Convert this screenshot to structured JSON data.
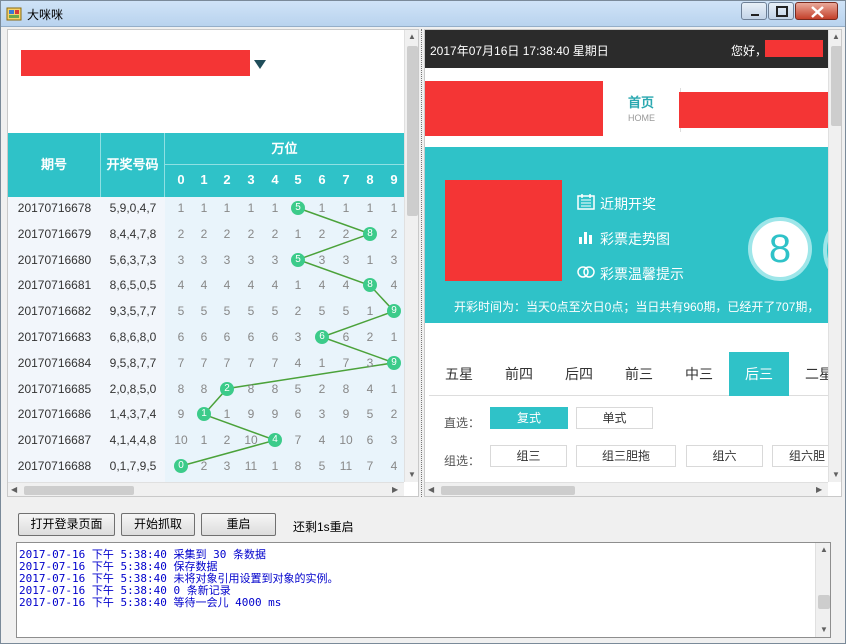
{
  "window": {
    "title": "大咪咪"
  },
  "left_pane": {
    "headers": {
      "qihao": "期号",
      "kaijiang": "开奖号码",
      "wanwei": "万位",
      "digits": [
        "0",
        "1",
        "2",
        "3",
        "4",
        "5",
        "6",
        "7",
        "8",
        "9"
      ]
    },
    "rows": [
      {
        "qihao": "20170716678",
        "kaijiang": "5,9,0,4,7",
        "cells": [
          "1",
          "1",
          "1",
          "1",
          "1",
          "5",
          "1",
          "1",
          "1",
          "1"
        ],
        "hit": 5
      },
      {
        "qihao": "20170716679",
        "kaijiang": "8,4,4,7,8",
        "cells": [
          "2",
          "2",
          "2",
          "2",
          "2",
          "1",
          "2",
          "2",
          "8",
          "2"
        ],
        "hit": 8
      },
      {
        "qihao": "20170716680",
        "kaijiang": "5,6,3,7,3",
        "cells": [
          "3",
          "3",
          "3",
          "3",
          "3",
          "5",
          "3",
          "3",
          "1",
          "3"
        ],
        "hit": 5
      },
      {
        "qihao": "20170716681",
        "kaijiang": "8,6,5,0,5",
        "cells": [
          "4",
          "4",
          "4",
          "4",
          "4",
          "1",
          "4",
          "4",
          "8",
          "4"
        ],
        "hit": 8
      },
      {
        "qihao": "20170716682",
        "kaijiang": "9,3,5,7,7",
        "cells": [
          "5",
          "5",
          "5",
          "5",
          "5",
          "2",
          "5",
          "5",
          "1",
          "9"
        ],
        "hit": 9
      },
      {
        "qihao": "20170716683",
        "kaijiang": "6,8,6,8,0",
        "cells": [
          "6",
          "6",
          "6",
          "6",
          "6",
          "3",
          "6",
          "6",
          "2",
          "1"
        ],
        "hit": 6
      },
      {
        "qihao": "20170716684",
        "kaijiang": "9,5,8,7,7",
        "cells": [
          "7",
          "7",
          "7",
          "7",
          "7",
          "4",
          "1",
          "7",
          "3",
          "9"
        ],
        "hit": 9
      },
      {
        "qihao": "20170716685",
        "kaijiang": "2,0,8,5,0",
        "cells": [
          "8",
          "8",
          "2",
          "8",
          "8",
          "5",
          "2",
          "8",
          "4",
          "1"
        ],
        "hit": 2
      },
      {
        "qihao": "20170716686",
        "kaijiang": "1,4,3,7,4",
        "cells": [
          "9",
          "1",
          "1",
          "9",
          "9",
          "6",
          "3",
          "9",
          "5",
          "2"
        ],
        "hit": 1
      },
      {
        "qihao": "20170716687",
        "kaijiang": "4,1,4,4,8",
        "cells": [
          "10",
          "1",
          "2",
          "10",
          "4",
          "7",
          "4",
          "10",
          "6",
          "3"
        ],
        "hit": 4
      },
      {
        "qihao": "20170716688",
        "kaijiang": "0,1,7,9,5",
        "cells": [
          "0",
          "2",
          "3",
          "11",
          "1",
          "8",
          "5",
          "11",
          "7",
          "4"
        ],
        "hit": 0
      }
    ]
  },
  "right_pane": {
    "datetime": "2017年07月16日 17:38:40 星期日",
    "hello": "您好，",
    "nav_home": "首页",
    "nav_home_en": "HOME",
    "banner_links": [
      "近期开奖",
      "彩票走势图",
      "彩票温馨提示"
    ],
    "big_number": "8",
    "banner_info": "开彩时间为：当天0点至次日0点；当日共有960期，已经开了707期，",
    "tabs": [
      "五星",
      "前四",
      "后四",
      "前三",
      "中三",
      "后三",
      "二星"
    ],
    "active_tab": "后三",
    "zhixuan_label": "直选：",
    "zhixuan_options": [
      "复式",
      "单式"
    ],
    "zuxuan_label": "组选：",
    "zuxuan_options": [
      "组三",
      "组三胆拖",
      "组六",
      "组六胆"
    ]
  },
  "controls": {
    "open_login": "打开登录页面",
    "start_fetch": "开始抓取",
    "restart": "重启",
    "countdown": "还剩1s重启"
  },
  "log": [
    "2017-07-16 下午 5:38:40 采集到 30 条数据",
    "2017-07-16 下午 5:38:40 保存数据",
    "2017-07-16 下午 5:38:40 未将对象引用设置到对象的实例。",
    "2017-07-16 下午 5:38:40 0 条新记录",
    "2017-07-16 下午 5:38:40 等待一会儿 4000 ms"
  ],
  "colors": {
    "accent": "#2fc2c8",
    "ball": "#3ccb8a",
    "trend_line": "#4ba23a",
    "redaction": "#f43535",
    "log_text": "#0000cc"
  }
}
